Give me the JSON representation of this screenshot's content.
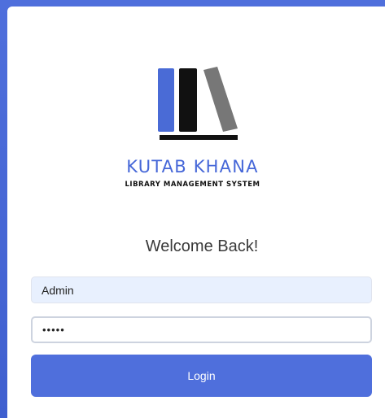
{
  "brand": {
    "title": "KUTAB KHANA",
    "subtitle": "LIBRARY MANAGEMENT SYSTEM"
  },
  "login": {
    "welcome": "Welcome Back!",
    "username_value": "Admin",
    "password_value": "admin",
    "login_label": "Login"
  },
  "colors": {
    "accent": "#4f6fdc",
    "book_blue": "#4a6bd6",
    "book_black": "#111111",
    "book_gray": "#777777"
  },
  "icons": {
    "logo": "books-logo-icon"
  }
}
